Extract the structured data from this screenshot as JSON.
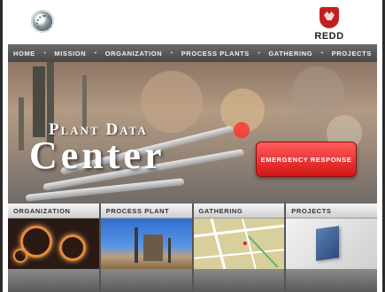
{
  "brand": {
    "right_logo_text": "REDD"
  },
  "nav": {
    "items": [
      "Home",
      "Mission",
      "Organization",
      "Process Plants",
      "Gathering",
      "Projects"
    ],
    "separator": "•"
  },
  "hero": {
    "title_line1": "Plant Data",
    "title_line2": "Center",
    "emergency_label": "Emergency Response"
  },
  "tiles": [
    {
      "label": "Organization",
      "icon": "orange-rings-image"
    },
    {
      "label": "Process Plant",
      "icon": "refinery-photo"
    },
    {
      "label": "Gathering",
      "icon": "map-image"
    },
    {
      "label": "Projects",
      "icon": "plant-sign-image"
    }
  ],
  "colors": {
    "nav_bg": "#5a5a5a",
    "emergency": "#e02020",
    "brand_red": "#c41f1f"
  }
}
